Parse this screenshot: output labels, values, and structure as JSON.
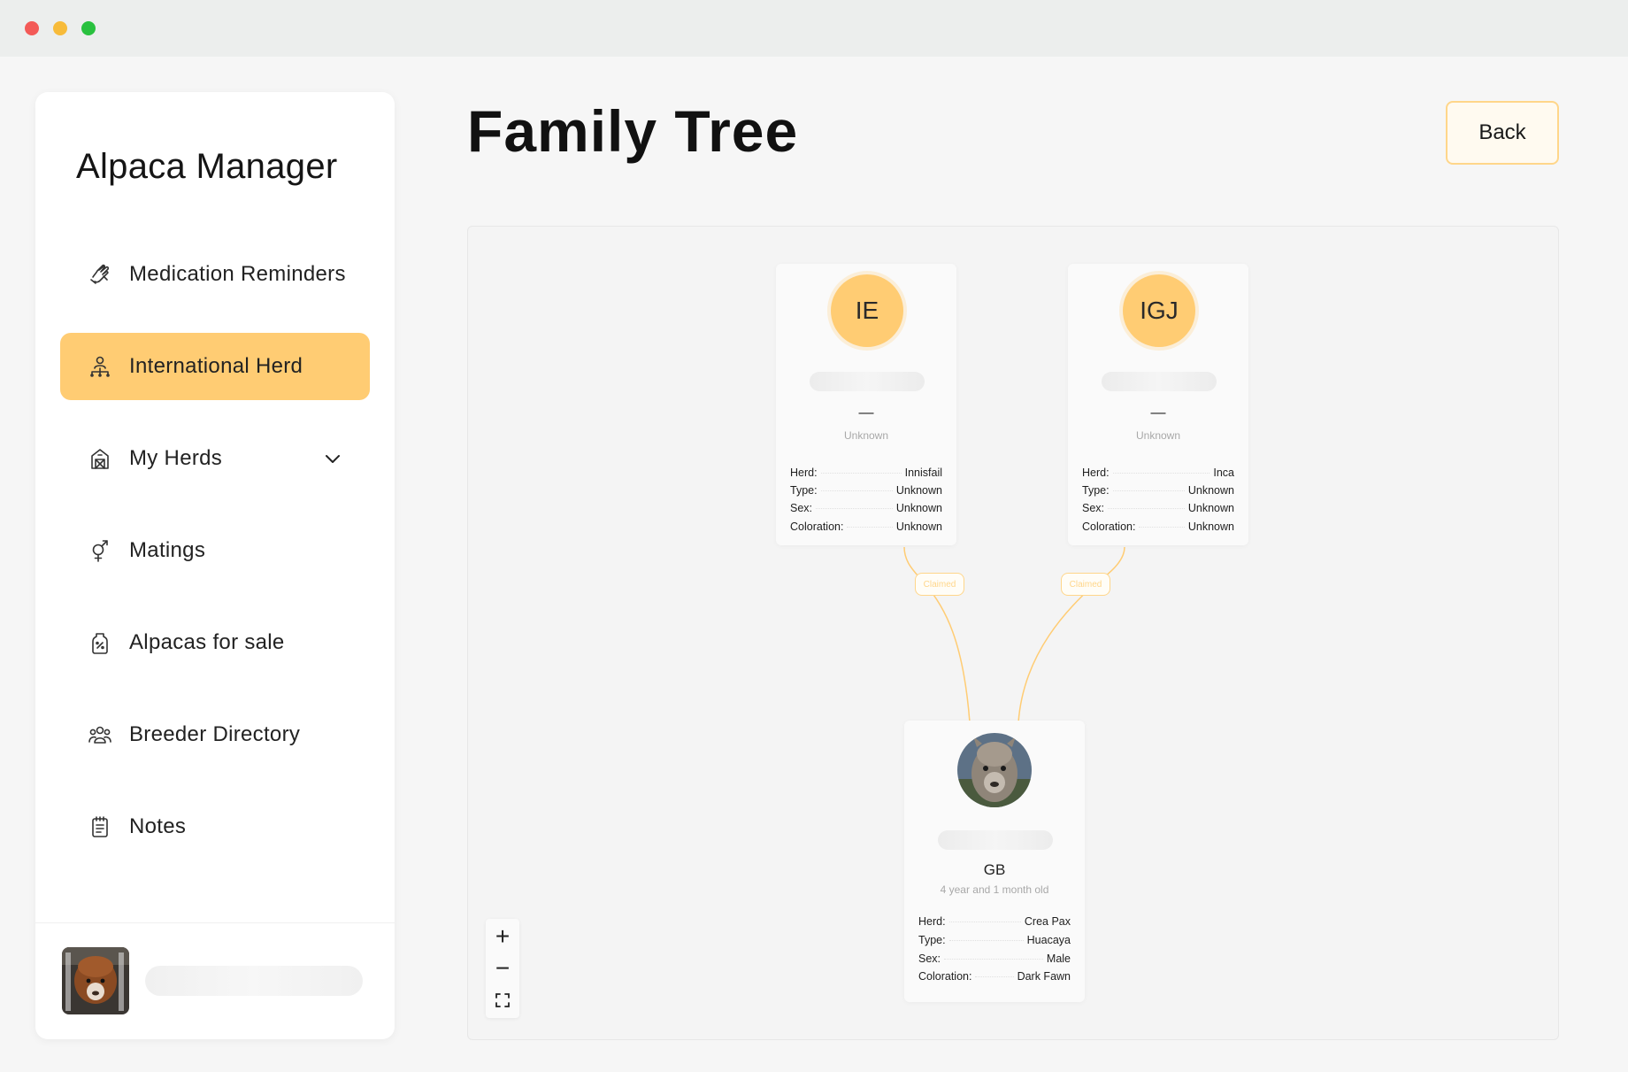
{
  "window": {
    "controls": [
      "close",
      "minimize",
      "maximize"
    ]
  },
  "sidebar": {
    "app_title": "Alpaca Manager",
    "items": [
      {
        "label": "Medication Reminders",
        "icon": "medication-hand-icon",
        "active": false
      },
      {
        "label": "International Herd",
        "icon": "herd-network-icon",
        "active": true
      },
      {
        "label": "My Herds",
        "icon": "barn-icon",
        "active": false,
        "expandable": true
      },
      {
        "label": "Matings",
        "icon": "gender-icon",
        "active": false
      },
      {
        "label": "Alpacas for sale",
        "icon": "price-tag-icon",
        "active": false
      },
      {
        "label": "Breeder Directory",
        "icon": "people-group-icon",
        "active": false
      },
      {
        "label": "Notes",
        "icon": "notes-icon",
        "active": false
      }
    ],
    "active_color": "#ffcc73"
  },
  "header": {
    "title": "Family Tree",
    "back_label": "Back"
  },
  "tree": {
    "sire": {
      "initials": "IE",
      "name": "—",
      "age": "Unknown",
      "fields": [
        {
          "label": "Herd:",
          "value": "Innisfail"
        },
        {
          "label": "Type:",
          "value": "Unknown"
        },
        {
          "label": "Sex:",
          "value": "Unknown"
        },
        {
          "label": "Coloration:",
          "value": "Unknown"
        }
      ],
      "link_label": "Claimed"
    },
    "dam": {
      "initials": "IGJ",
      "name": "—",
      "age": "Unknown",
      "fields": [
        {
          "label": "Herd:",
          "value": "Inca"
        },
        {
          "label": "Type:",
          "value": "Unknown"
        },
        {
          "label": "Sex:",
          "value": "Unknown"
        },
        {
          "label": "Coloration:",
          "value": "Unknown"
        }
      ],
      "link_label": "Claimed"
    },
    "child": {
      "name": "GB",
      "age": "4 year and 1 month old",
      "fields": [
        {
          "label": "Herd:",
          "value": "Crea Pax"
        },
        {
          "label": "Type:",
          "value": "Huacaya"
        },
        {
          "label": "Sex:",
          "value": "Male"
        },
        {
          "label": "Coloration:",
          "value": "Dark Fawn"
        }
      ]
    },
    "connector_color": "#ffcc73"
  },
  "zoom": {
    "zoom_in": "+",
    "zoom_out": "−"
  }
}
